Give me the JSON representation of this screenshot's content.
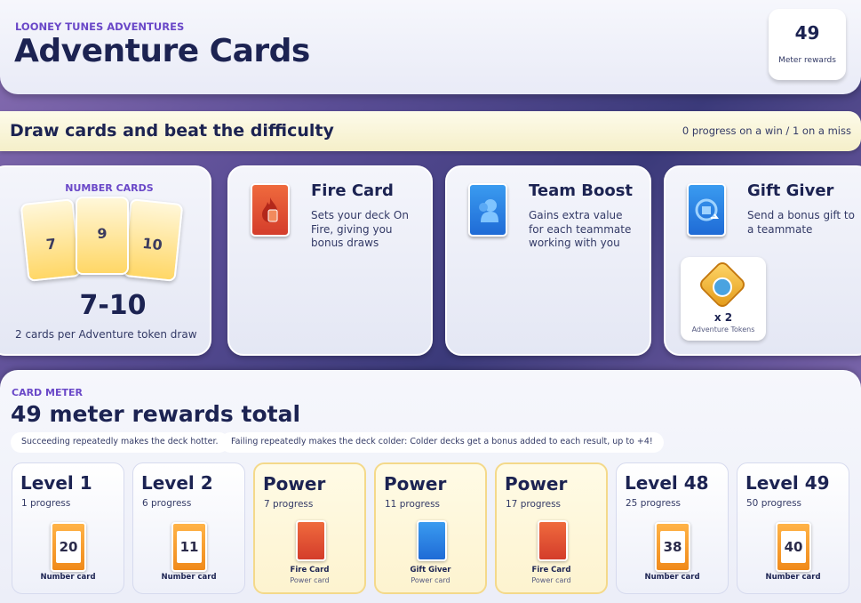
{
  "header": {
    "eyebrow": "LOONEY TUNES ADVENTURES",
    "title": "Adventure Cards",
    "meter_count": "49",
    "meter_label": "Meter rewards"
  },
  "banner": {
    "title": "Draw cards and beat the difficulty",
    "note": "0 progress on a win / 1 on a miss"
  },
  "number_cards": {
    "title": "NUMBER CARDS",
    "values": [
      "7",
      "9",
      "10"
    ],
    "range": "7-10",
    "note": "2 cards per Adventure token draw"
  },
  "powers": [
    {
      "title": "Fire Card",
      "desc": "Sets your deck On Fire, giving you bonus draws",
      "icon": "fire-icon"
    },
    {
      "title": "Team Boost",
      "desc": "Gains extra value for each teammate working with you",
      "icon": "teammate-icon"
    },
    {
      "title": "Gift Giver",
      "desc": "Send a bonus gift to a teammate",
      "icon": "gift-icon"
    }
  ],
  "token": {
    "qty": "x 2",
    "label": "Adventure Tokens",
    "icon": "adventure-token-icon"
  },
  "meter": {
    "eyebrow": "CARD METER",
    "title": "49 meter rewards total",
    "hint_hot": "Succeeding repeatedly makes the deck hotter.",
    "hint_cold": "Failing repeatedly makes the deck colder: Colder decks get a bonus added to each result, up to +4!"
  },
  "levels": [
    {
      "name": "Level 1",
      "progress": "1 progress",
      "value": "20",
      "type": "Number card"
    },
    {
      "name": "Level 2",
      "progress": "6 progress",
      "value": "11",
      "type": "Number card"
    },
    {
      "name": "Power",
      "progress": "7 progress",
      "type": "Fire Card",
      "sub": "Power card"
    },
    {
      "name": "Power",
      "progress": "11 progress",
      "type": "Gift Giver",
      "sub": "Power card"
    },
    {
      "name": "Power",
      "progress": "17 progress",
      "type": "Fire Card",
      "sub": "Power card"
    },
    {
      "name": "Level 48",
      "progress": "25 progress",
      "value": "38",
      "type": "Number card"
    },
    {
      "name": "Level 49",
      "progress": "50 progress",
      "value": "40",
      "type": "Number card"
    }
  ],
  "colors": {
    "accent": "#6a48c8",
    "text": "#1c2352",
    "fire": "#d43d2b",
    "blue": "#1f6bd6",
    "number": "#f08a1a"
  }
}
